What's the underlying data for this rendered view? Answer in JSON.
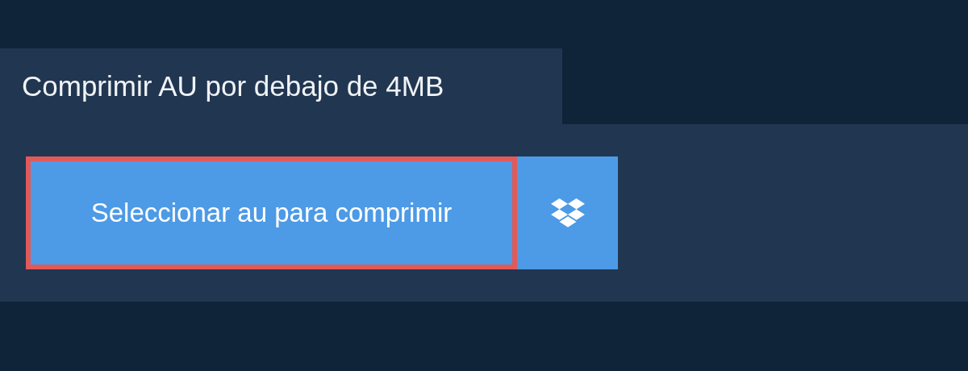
{
  "tab": {
    "title": "Comprimir AU por debajo de 4MB"
  },
  "upload": {
    "label": "Seleccionar au para comprimir"
  }
}
